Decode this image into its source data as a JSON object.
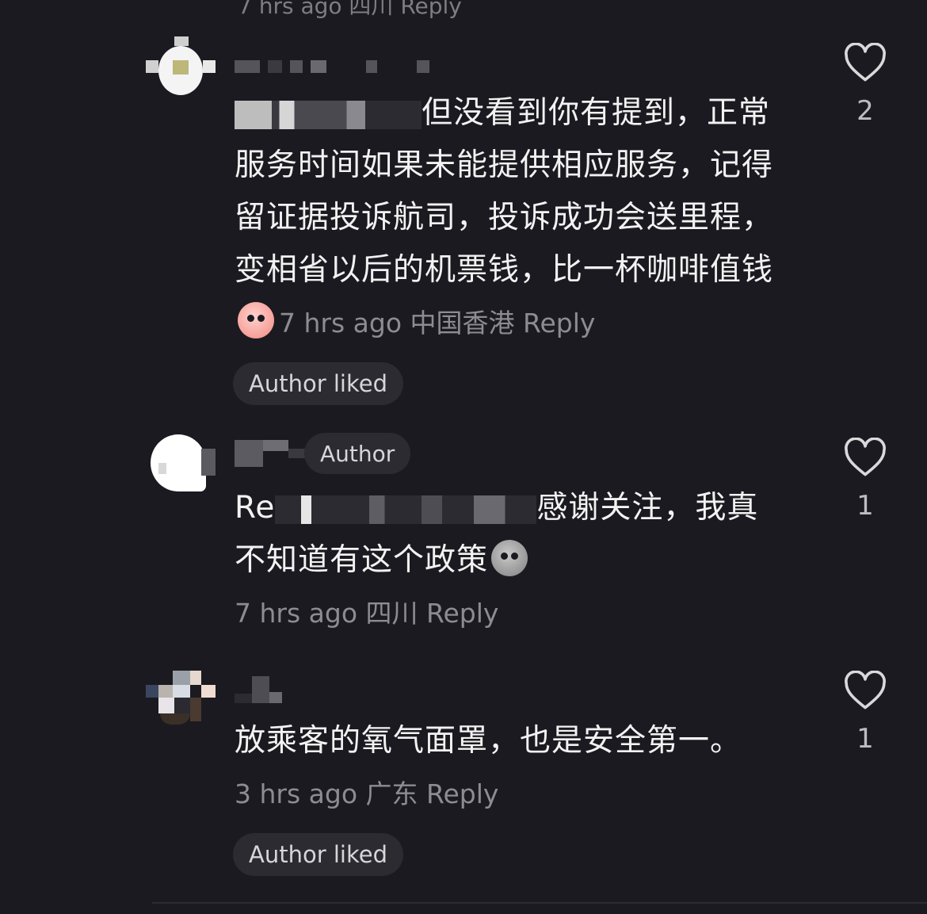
{
  "top_partial_text": "7 hrs ago 四川 Reply",
  "colors": {
    "background": "#1b1a20",
    "text": "#f2f2f2",
    "meta": "#8c8c91",
    "pill": "#2c2b31"
  },
  "comments": [
    {
      "text_visible": "但没看到你有提到，正常服务时间如果未能提供相应服务，记得留证据投诉航司，投诉成功会送里程，变相省以后的机票钱，比一杯咖啡值钱",
      "emoji": "blush-emoji",
      "time": "7 hrs ago",
      "location": "中国香港",
      "reply_label": "Reply",
      "author_liked": "Author liked",
      "like_count": "2",
      "like_icon": "heart-outline-icon"
    },
    {
      "author_badge": "Author",
      "text_prefix": "Re",
      "text_visible": "感谢关注，我真不知道有这个政策",
      "emoji": "shocked-emoji",
      "time": "7 hrs ago",
      "location": "四川",
      "reply_label": "Reply",
      "like_count": "1",
      "like_icon": "heart-outline-icon"
    },
    {
      "text_visible": "放乘客的氧气面罩，也是安全第一。",
      "time": "3 hrs ago",
      "location": "广东",
      "reply_label": "Reply",
      "author_liked": "Author liked",
      "like_count": "1",
      "like_icon": "heart-outline-icon"
    }
  ]
}
